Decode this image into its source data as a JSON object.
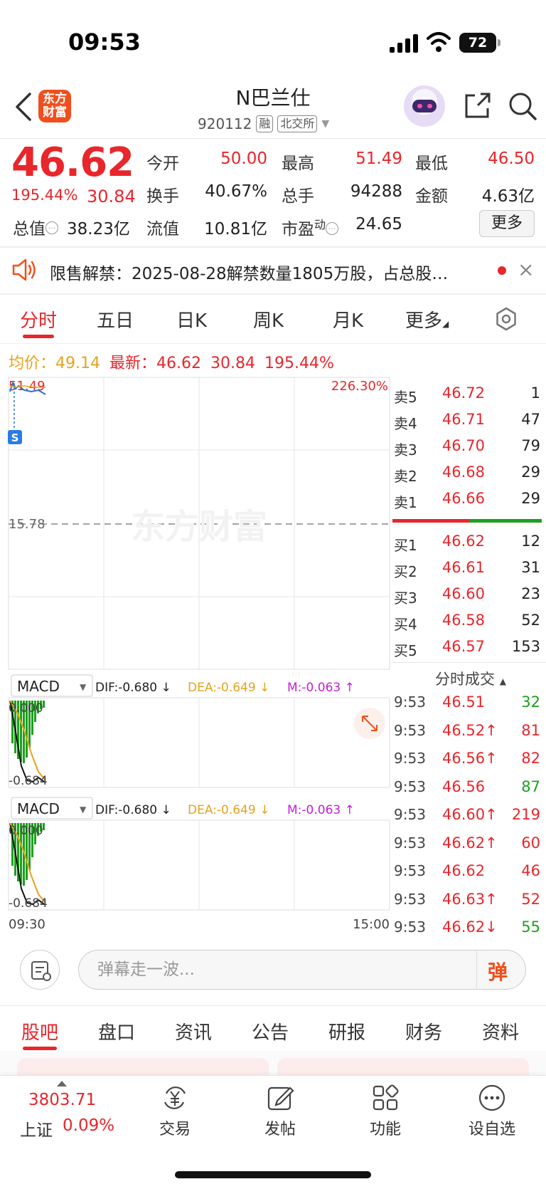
{
  "status": {
    "time": "09:53",
    "battery": "72"
  },
  "header": {
    "logo_text_1": "东方",
    "logo_text_2": "财富",
    "stock_name": "N巴兰仕",
    "code": "920112",
    "tag_margin": "融",
    "tag_exchange": "北交所"
  },
  "quote": {
    "price": "46.62",
    "change_pct": "195.44%",
    "change": "30.84",
    "open_label": "今开",
    "open": "50.00",
    "high_label": "最高",
    "high": "51.49",
    "low_label": "最低",
    "low": "46.50",
    "turnover_label": "换手",
    "turnover": "40.67%",
    "volume_label": "总手",
    "volume": "94288",
    "amount_label": "金额",
    "amount": "4.63亿",
    "mktcap_label": "总值",
    "mktcap": "38.23亿",
    "float_label": "流值",
    "float": "10.81亿",
    "pe_label": "市盈",
    "pe_sup": "动",
    "pe": "24.65",
    "more_button": "更多"
  },
  "notice": {
    "text": "限售解禁：2025-08-28解禁数量1805万股，占总股…",
    "close": "×"
  },
  "chart_tabs": [
    "分时",
    "五日",
    "日K",
    "周K",
    "月K",
    "更多"
  ],
  "summary": {
    "avg_label": "均价：",
    "avg": "49.14",
    "latest_label": "最新：",
    "latest": "46.62",
    "latest_change": "30.84",
    "latest_pct": "195.44%"
  },
  "chart": {
    "top_left_label": "51.49",
    "top_right_label": "226.30%",
    "mid_label": "15.78",
    "s_marker": "S",
    "watermark": "东方财富",
    "x_start": "09:30",
    "x_end": "15:00",
    "colors": {
      "up": "#e8262b",
      "down": "#1ea01e",
      "avg": "#e8a21c",
      "price_line": "#2a6fd6"
    }
  },
  "macd": {
    "selector": "MACD",
    "dif": "DIF:-0.680 ↓",
    "dea": "DEA:-0.649 ↓",
    "m": "M:-0.063 ↑",
    "top": "0.000",
    "bottom": "-0.684"
  },
  "order_book": {
    "asks": [
      {
        "label": "卖5",
        "price": "46.72",
        "vol": "1"
      },
      {
        "label": "卖4",
        "price": "46.71",
        "vol": "47"
      },
      {
        "label": "卖3",
        "price": "46.70",
        "vol": "79"
      },
      {
        "label": "卖2",
        "price": "46.68",
        "vol": "29"
      },
      {
        "label": "卖1",
        "price": "46.66",
        "vol": "29"
      }
    ],
    "bids": [
      {
        "label": "买1",
        "price": "46.62",
        "vol": "12"
      },
      {
        "label": "买2",
        "price": "46.61",
        "vol": "31"
      },
      {
        "label": "买3",
        "price": "46.60",
        "vol": "23"
      },
      {
        "label": "买4",
        "price": "46.58",
        "vol": "52"
      },
      {
        "label": "买5",
        "price": "46.57",
        "vol": "153"
      }
    ]
  },
  "ticks": {
    "title": "分时成交",
    "rows": [
      {
        "time": "9:53",
        "price": "46.51",
        "vol": "32",
        "dir": "",
        "color": "green"
      },
      {
        "time": "9:53",
        "price": "46.52↑",
        "vol": "81",
        "dir": "up",
        "color": "red"
      },
      {
        "time": "9:53",
        "price": "46.56↑",
        "vol": "82",
        "dir": "up",
        "color": "red"
      },
      {
        "time": "9:53",
        "price": "46.56",
        "vol": "87",
        "dir": "",
        "color": "green"
      },
      {
        "time": "9:53",
        "price": "46.60↑",
        "vol": "219",
        "dir": "up",
        "color": "red"
      },
      {
        "time": "9:53",
        "price": "46.62↑",
        "vol": "60",
        "dir": "up",
        "color": "red"
      },
      {
        "time": "9:53",
        "price": "46.62",
        "vol": "46",
        "dir": "",
        "color": "red"
      },
      {
        "time": "9:53",
        "price": "46.63↑",
        "vol": "52",
        "dir": "up",
        "color": "red"
      },
      {
        "time": "9:53",
        "price": "46.62↓",
        "vol": "55",
        "dir": "down",
        "color": "green"
      }
    ]
  },
  "comment": {
    "placeholder": "弹幕走一波...",
    "danmu": "弹"
  },
  "bottom_tabs": [
    "股吧",
    "盘口",
    "资讯",
    "公告",
    "研报",
    "财务",
    "资料"
  ],
  "tabbar": {
    "index_value": "3803.71",
    "index_name": "上证",
    "index_pct": "0.09%",
    "items": [
      "交易",
      "发帖",
      "功能",
      "设自选"
    ]
  }
}
